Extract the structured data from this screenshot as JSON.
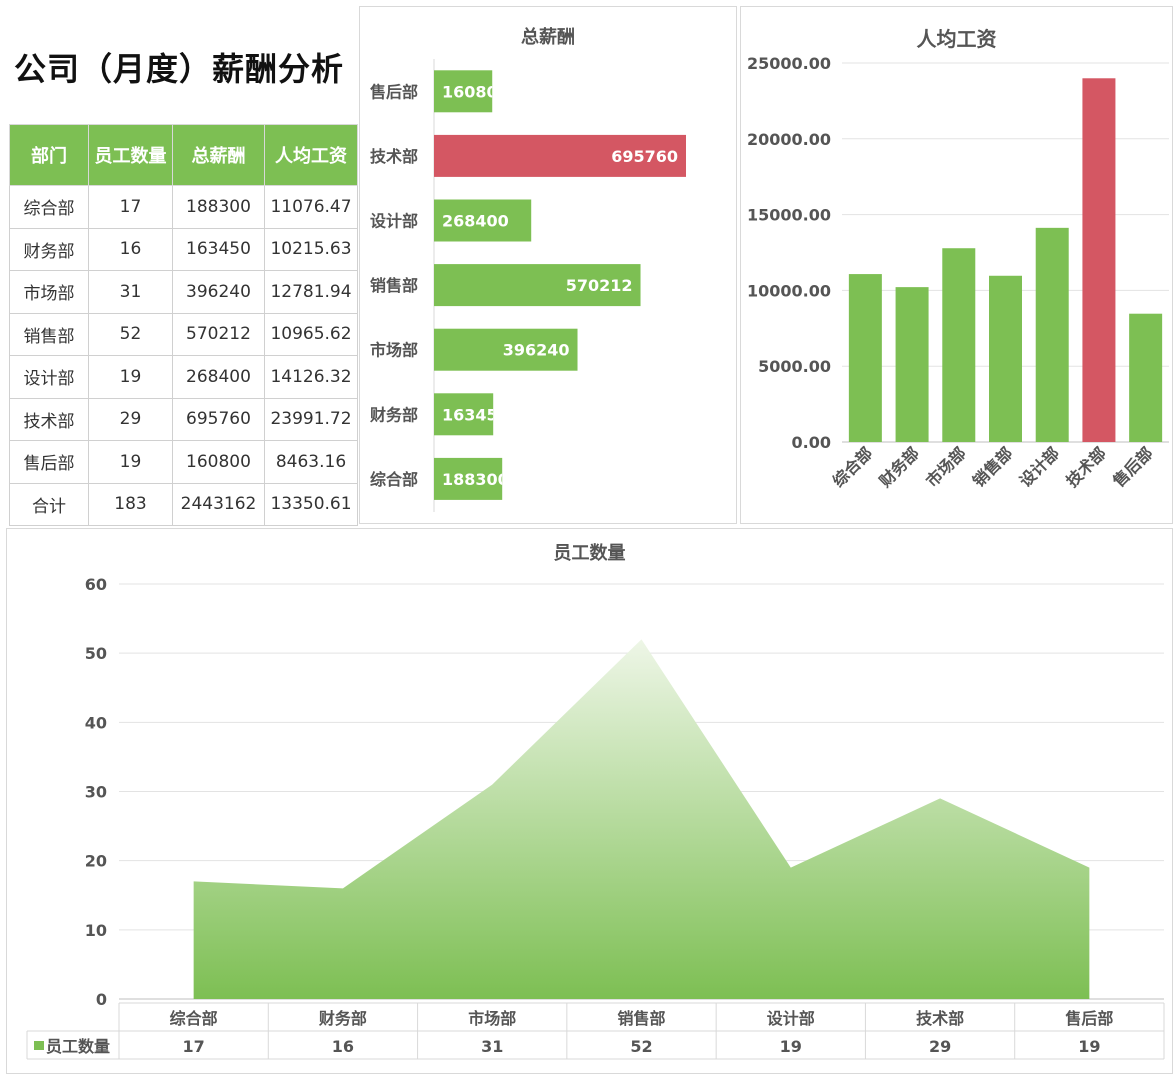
{
  "page": {
    "title": "公司（月度）薪酬分析"
  },
  "table": {
    "headers": [
      "部门",
      "员工数量",
      "总薪酬",
      "人均工资"
    ],
    "rows": [
      [
        "综合部",
        "17",
        "188300",
        "11076.47"
      ],
      [
        "财务部",
        "16",
        "163450",
        "10215.63"
      ],
      [
        "市场部",
        "31",
        "396240",
        "12781.94"
      ],
      [
        "销售部",
        "52",
        "570212",
        "10965.62"
      ],
      [
        "设计部",
        "19",
        "268400",
        "14126.32"
      ],
      [
        "技术部",
        "29",
        "695760",
        "23991.72"
      ],
      [
        "售后部",
        "19",
        "160800",
        "8463.16"
      ],
      [
        "合计",
        "183",
        "2443162",
        "13350.61"
      ]
    ]
  },
  "colors": {
    "green": "#7dbf53",
    "red": "#d45763",
    "header_text": "#ffffff"
  },
  "chart_data": [
    {
      "type": "bar",
      "orientation": "horizontal",
      "title": "总薪酬",
      "categories": [
        "售后部",
        "技术部",
        "设计部",
        "销售部",
        "市场部",
        "财务部",
        "综合部"
      ],
      "values": [
        160800,
        695760,
        268400,
        570212,
        396240,
        163450,
        188300
      ],
      "labels": [
        "16080",
        "695760",
        "268400",
        "570212",
        "396240",
        "16345",
        "188300"
      ],
      "highlight": "技术部",
      "xlim": [
        0,
        750000
      ]
    },
    {
      "type": "bar",
      "title": "人均工资",
      "categories": [
        "综合部",
        "财务部",
        "市场部",
        "销售部",
        "设计部",
        "技术部",
        "售后部"
      ],
      "values": [
        11076.47,
        10215.63,
        12781.94,
        10965.62,
        14126.32,
        23991.72,
        8463.16
      ],
      "highlight": "技术部",
      "ylim": [
        0,
        25000
      ],
      "yticks": [
        "0.00",
        "5000.00",
        "10000.00",
        "15000.00",
        "20000.00",
        "25000.00"
      ],
      "grid": true
    },
    {
      "type": "area",
      "title": "员工数量",
      "categories": [
        "综合部",
        "财务部",
        "市场部",
        "销售部",
        "设计部",
        "技术部",
        "售后部"
      ],
      "series": [
        {
          "name": "员工数量",
          "values": [
            17,
            16,
            31,
            52,
            19,
            29,
            19
          ]
        }
      ],
      "ylim": [
        0,
        60
      ],
      "yticks": [
        "0",
        "10",
        "20",
        "30",
        "40",
        "50",
        "60"
      ],
      "grid": true,
      "data_table": true
    }
  ]
}
